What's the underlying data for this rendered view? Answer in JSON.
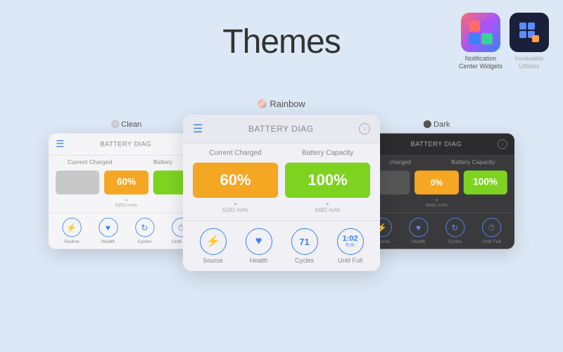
{
  "page": {
    "title": "Themes",
    "background": "#dce8f5"
  },
  "badges": [
    {
      "id": "ncw",
      "label": "Notification\nCenter Widgets",
      "icon": "🎛️",
      "bg": "gradient"
    },
    {
      "id": "iu",
      "label": "Invaluable\nUtilities",
      "icon": "⚡",
      "bg": "#1a1f3a"
    }
  ],
  "themes": {
    "clean": {
      "label": "Clean",
      "dot_color": "#d0d0d5",
      "header_title": "BATTERY DIAG",
      "col1": "Current Charged",
      "col2": "Battery",
      "charged_pct": "60%",
      "capacity_pct": "",
      "mah": "6353 mAh",
      "icons": [
        "Source",
        "Health",
        "Cycles",
        "Until Full"
      ]
    },
    "rainbow": {
      "label": "Rainbow",
      "dot_color": "linear-gradient(135deg, #ff9a9e, #fad0c4)",
      "header_title": "BATTERY DIAG",
      "col1": "Current Charged",
      "col2": "Battery Capacity",
      "charged_pct": "60%",
      "capacity_pct": "100%",
      "mah1": "6291 mAh",
      "mah2": "8482 mAh",
      "cycle_num": "71",
      "until_full": "1:02",
      "until_full_sub": "h:m",
      "icons": [
        "Source",
        "Health",
        "Cycles",
        "Until Full"
      ]
    },
    "dark": {
      "label": "Dark",
      "dot_color": "#555",
      "header_title": "BATTERY DIAG",
      "col1": "charged",
      "col2": "Battery Capacity",
      "charged_pct": "0%",
      "capacity_pct": "100%",
      "mah": "8482 mAh",
      "icons": [
        "Source",
        "Health",
        "Cycles",
        "Until Full"
      ]
    }
  }
}
